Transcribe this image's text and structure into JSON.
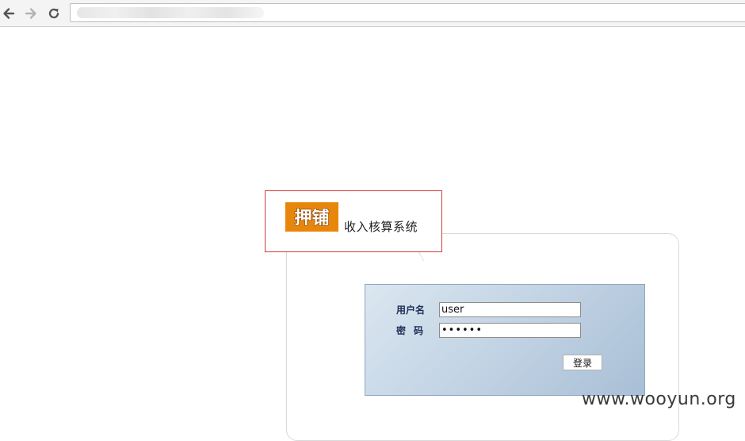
{
  "browser": {
    "back_icon": "back-arrow-icon",
    "forward_icon": "forward-arrow-icon",
    "reload_icon": "reload-icon"
  },
  "header": {
    "logo_text": "押铺",
    "title": "收入核算系统",
    "brand_color": "#e8860b"
  },
  "login": {
    "username_label": "用户名",
    "password_label": "密码",
    "username_value": "user",
    "password_value": "••••••",
    "submit_label": "登录"
  },
  "watermark": "www.wooyun.org"
}
